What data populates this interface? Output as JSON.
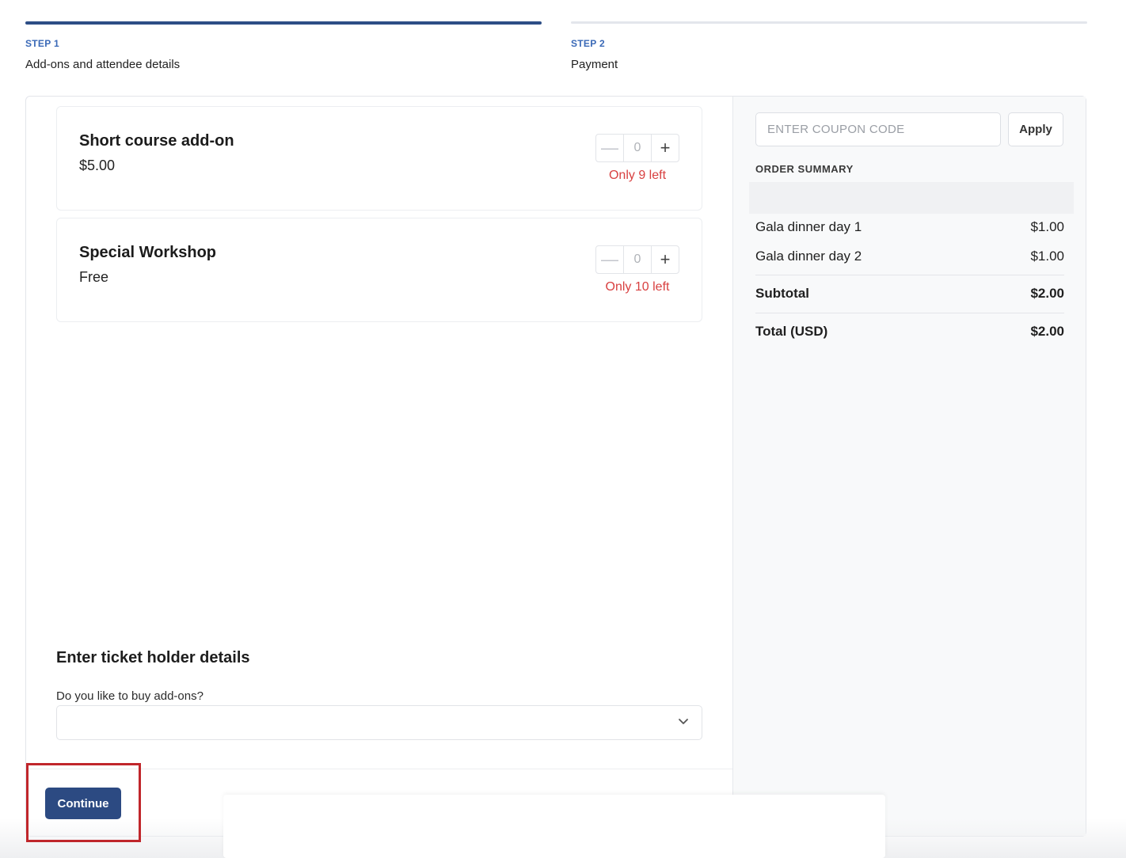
{
  "steps": [
    {
      "label": "STEP 1",
      "title": "Add-ons and attendee details"
    },
    {
      "label": "STEP 2",
      "title": "Payment"
    }
  ],
  "addons": [
    {
      "name": "Short course add-on",
      "price": "$5.00",
      "quantity": "0",
      "stock": "Only 9 left"
    },
    {
      "name": "Special Workshop",
      "price": "Free",
      "quantity": "0",
      "stock": "Only 10 left"
    }
  ],
  "ticket_holder": {
    "heading": "Enter ticket holder details",
    "question": "Do you like to buy add-ons?"
  },
  "actions": {
    "continue_label": "Continue"
  },
  "coupon": {
    "placeholder": "ENTER COUPON CODE",
    "apply_label": "Apply"
  },
  "summary": {
    "label": "ORDER SUMMARY",
    "items": [
      {
        "name": "Gala dinner day 1",
        "price": "$1.00"
      },
      {
        "name": "Gala dinner day 2",
        "price": "$1.00"
      }
    ],
    "subtotal_label": "Subtotal",
    "subtotal": "$2.00",
    "total_label": "Total (USD)",
    "total": "$2.00"
  },
  "colors": {
    "accent": "#2c4a82",
    "step_label": "#3a69b7",
    "stock_warning": "#d84040",
    "highlight": "#c0262b"
  },
  "icons": {
    "minus": "minus-icon",
    "plus": "plus-icon",
    "dropdown": "chevron-down-icon"
  }
}
